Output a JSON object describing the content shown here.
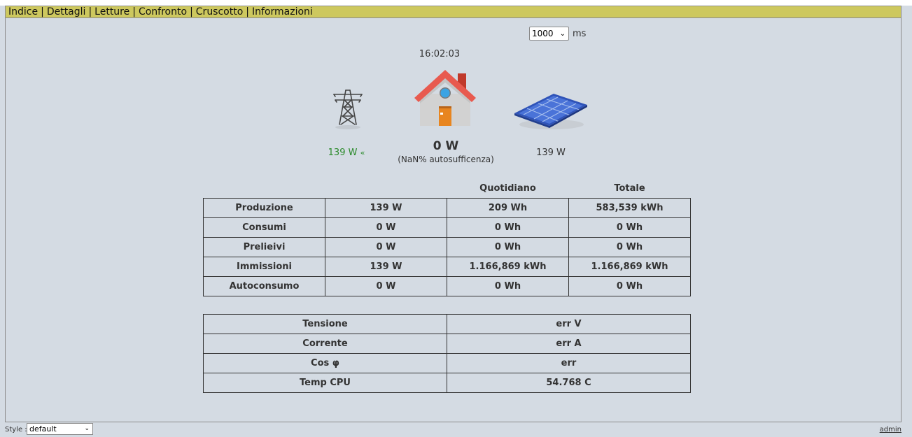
{
  "nav": {
    "items": [
      "Indice",
      "Dettagli",
      "Letture",
      "Confronto",
      "Cruscotto",
      "Informazioni"
    ],
    "separator": "|"
  },
  "refresh": {
    "value": "1000",
    "unit": "ms"
  },
  "clock": "16:02:03",
  "flows": {
    "grid": "139 W",
    "grid_direction_glyph": "«",
    "house": "0 W",
    "house_sub": "(NaN% autosufficenza)",
    "solar": "139 W"
  },
  "energy_table": {
    "headers": [
      "",
      "",
      "Quotidiano",
      "Totale"
    ],
    "rows": [
      [
        "Produzione",
        "139 W",
        "209 Wh",
        "583,539 kWh"
      ],
      [
        "Consumi",
        "0 W",
        "0 Wh",
        "0 Wh"
      ],
      [
        "Prelieivi",
        "0 W",
        "0 Wh",
        "0 Wh"
      ],
      [
        "Immissioni",
        "139 W",
        "1.166,869 kWh",
        "1.166,869 kWh"
      ],
      [
        "Autoconsumo",
        "0 W",
        "0 Wh",
        "0 Wh"
      ]
    ]
  },
  "info_table": {
    "rows": [
      [
        "Tensione",
        "err V"
      ],
      [
        "Corrente",
        "err A"
      ],
      [
        "Cos φ",
        "err"
      ],
      [
        "Temp CPU",
        "54.768 C"
      ]
    ]
  },
  "footer": {
    "style_label": "Style :",
    "style_value": "default",
    "admin_link": "admin"
  },
  "icons": {
    "grid": "power-pylon-icon",
    "house": "house-icon",
    "solar": "solar-panel-icon"
  },
  "colors": {
    "background": "#d4dbe3",
    "navbar": "#cdc85e",
    "grid_value": "#2a8a2a",
    "roof": "#e05a4e",
    "panel": "#3a5fc4"
  }
}
